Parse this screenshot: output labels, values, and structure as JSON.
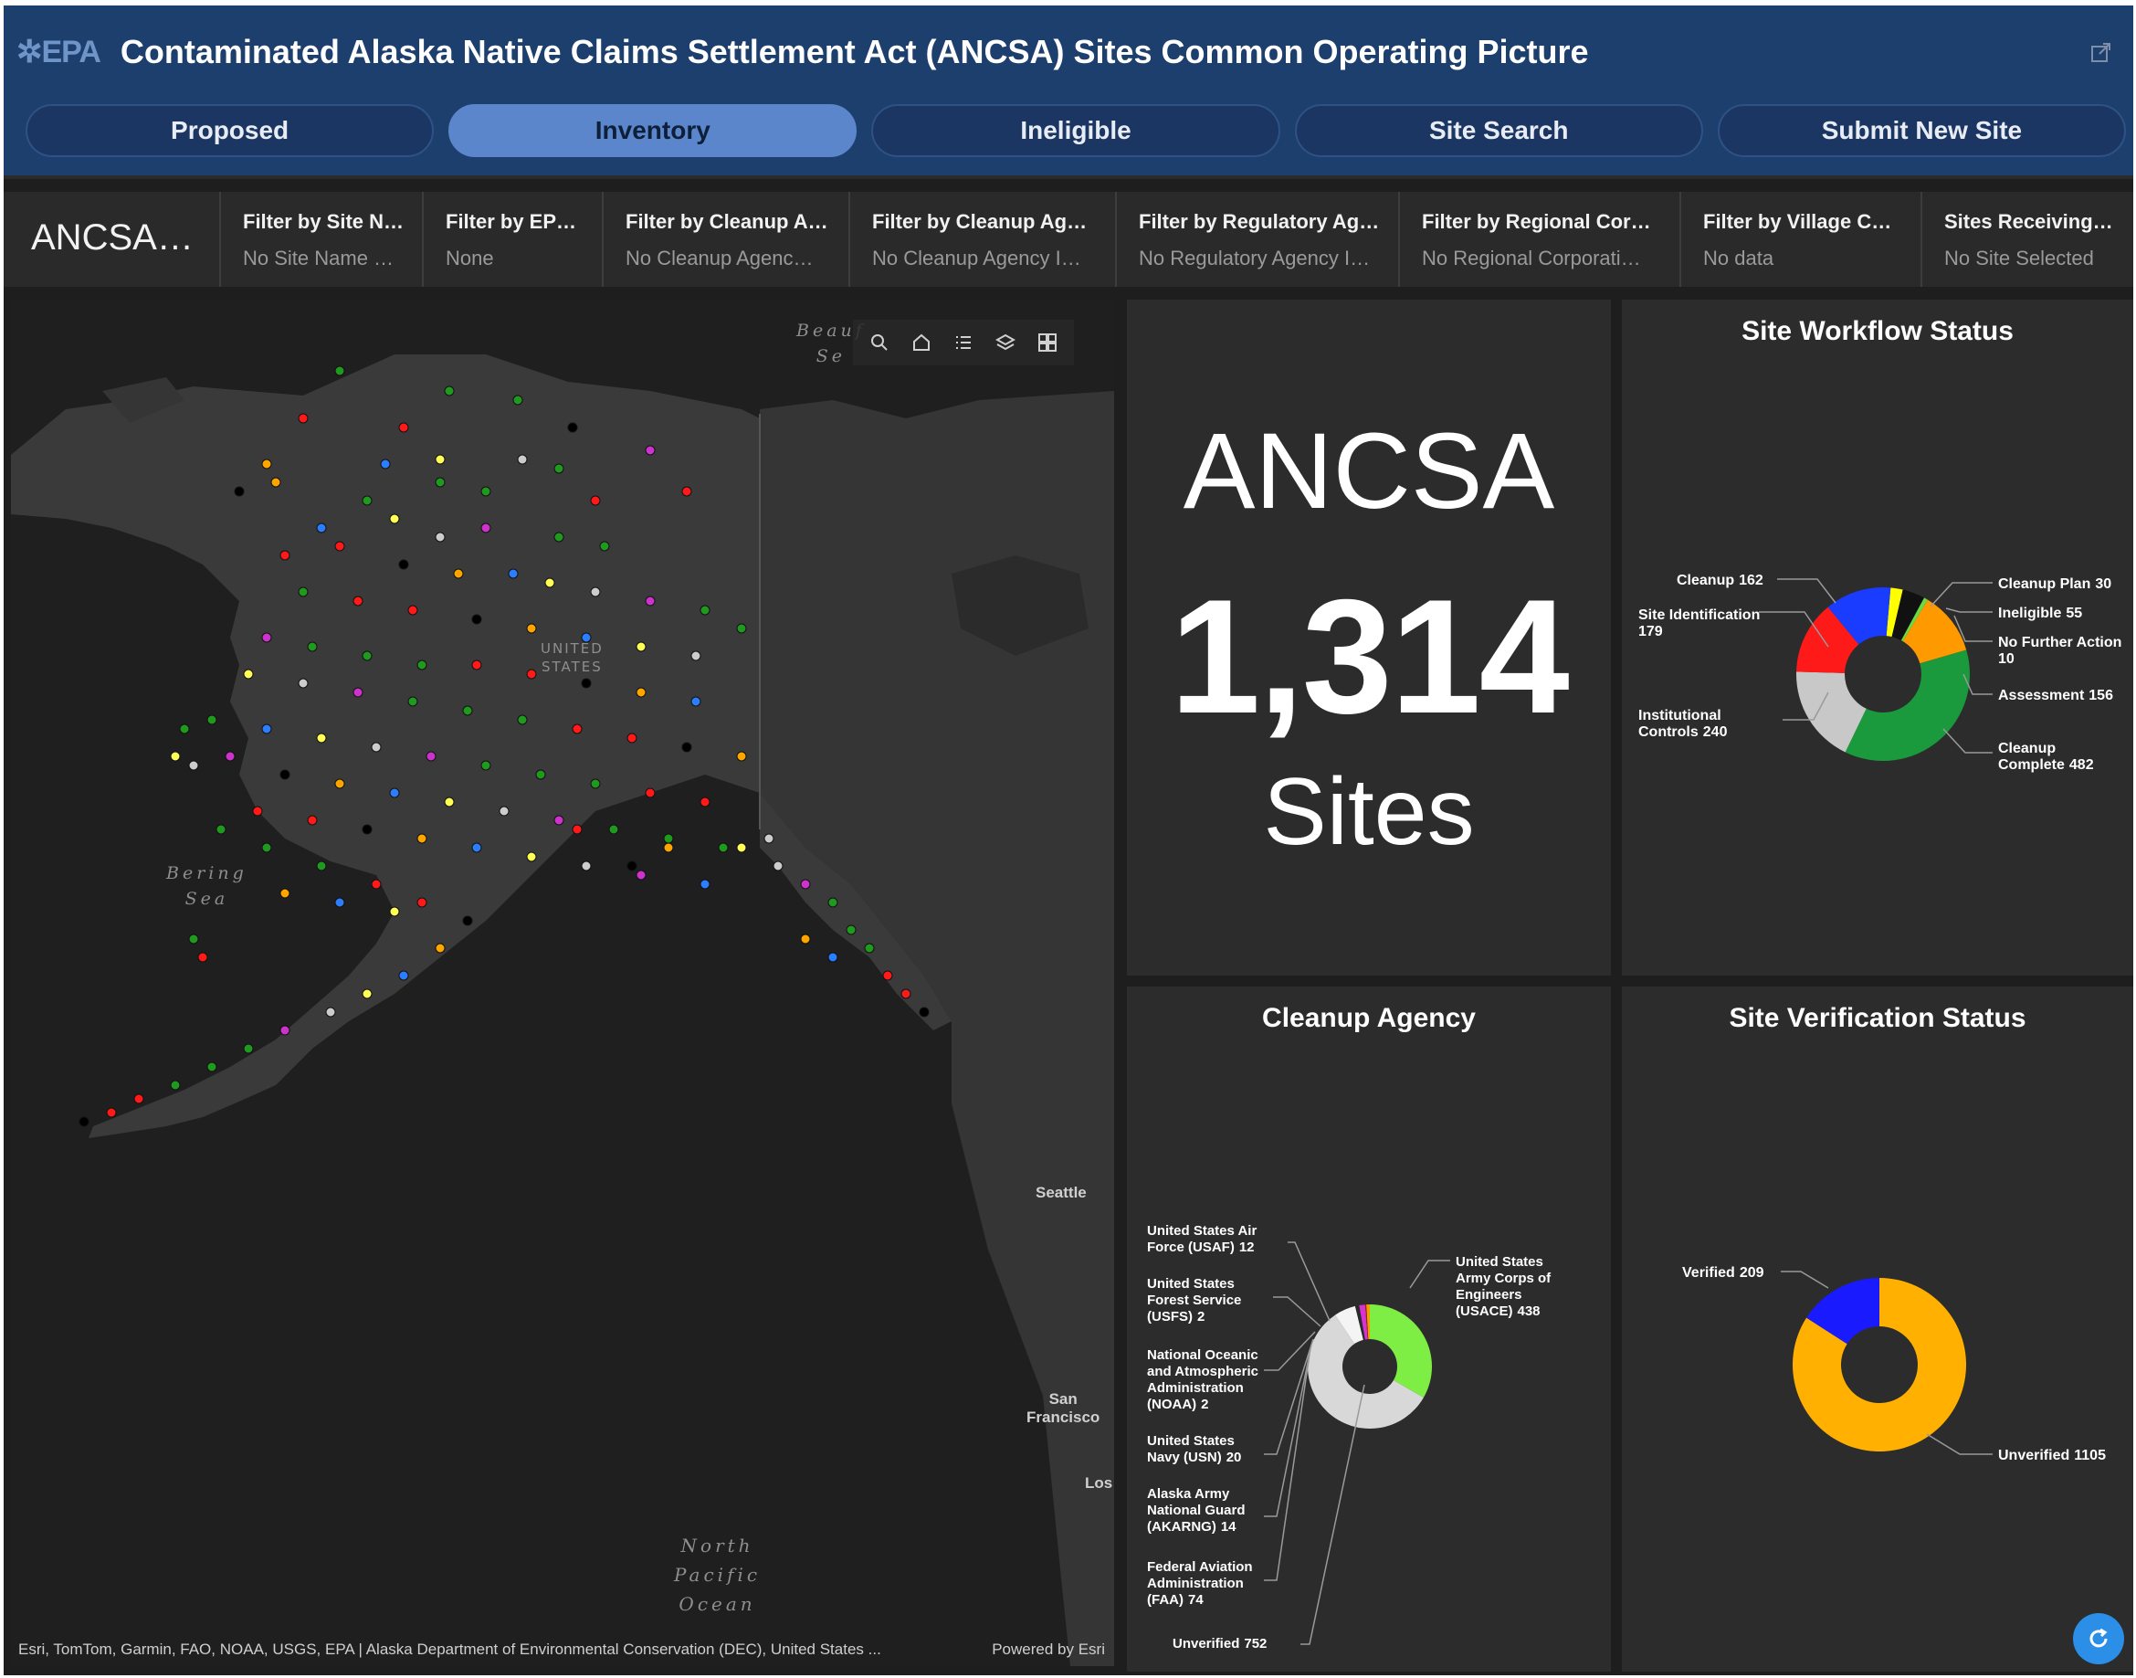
{
  "header": {
    "logo_text": "✲EPA",
    "title": "Contaminated  Alaska Native Claims Settlement Act (ANCSA) Sites Common Operating Picture",
    "share_icon": "share-icon"
  },
  "tabs": [
    {
      "label": "Proposed",
      "active": false
    },
    {
      "label": "Inventory",
      "active": true
    },
    {
      "label": "Ineligible",
      "active": false
    },
    {
      "label": "Site Search",
      "active": false
    },
    {
      "label": "Submit New Site",
      "active": false
    }
  ],
  "filters": {
    "selector_label": "ANCSA…",
    "items": [
      {
        "label": "Filter by Site N…",
        "value": "No Site Name …"
      },
      {
        "label": "Filter by EP…",
        "value": "None"
      },
      {
        "label": "Filter by Cleanup A…",
        "value": "No Cleanup Agenc…"
      },
      {
        "label": "Filter by Cleanup Ag…",
        "value": "No Cleanup Agency I…"
      },
      {
        "label": "Filter by Regulatory Ag…",
        "value": "No Regulatory Agency I…"
      },
      {
        "label": "Filter by Regional Corp…",
        "value": "No Regional Corporati…"
      },
      {
        "label": "Filter by Village C…",
        "value": "No data"
      },
      {
        "label": "Sites Receiving E…",
        "value": "No Site Selected"
      }
    ]
  },
  "map": {
    "labels": {
      "beaufort": "Beauf\nSe",
      "united_states": "UNITED\nSTATES",
      "bering": "Bering\nSea",
      "north_pacific": "North\nPacific\nOcean",
      "seattle": "Seattle",
      "san_francisco": "San\nFrancisco",
      "los": "Los"
    },
    "attribution": "Esri, TomTom, Garmin, FAO, NOAA, USGS, EPA | Alaska Department of Environmental Conservation (DEC), United States ...",
    "powered_by": "Powered by Esri",
    "tools": [
      "search-icon",
      "home-icon",
      "legend-icon",
      "layers-icon",
      "basemap-icon"
    ]
  },
  "indicator": {
    "label": "ANCSA",
    "value": "1,314",
    "unit": "Sites"
  },
  "colors": {
    "cleanup_complete": "#1a9a3c",
    "institutional_controls": "#c8c8c8",
    "site_identification": "#ff1a1a",
    "cleanup": "#1a3cff",
    "cleanup_plan": "#ffff00",
    "ineligible": "#111111",
    "no_further_action": "#66dd44",
    "assessment": "#ff9900",
    "verified": "#1a1aff",
    "unverified": "#ffb000",
    "usace": "#7fee44",
    "unverified_agency": "#d8d8d8"
  },
  "chart_data": [
    {
      "type": "pie",
      "title": "Site Workflow Status",
      "slices": [
        {
          "label": "Cleanup Plan 30",
          "name": "Cleanup Plan",
          "value": 30
        },
        {
          "label": "Ineligible 55",
          "name": "Ineligible",
          "value": 55
        },
        {
          "label": "No Further Action 10",
          "name": "No Further Action",
          "value": 10
        },
        {
          "label": "Assessment 156",
          "name": "Assessment",
          "value": 156
        },
        {
          "label": "Cleanup Complete 482",
          "name": "Cleanup Complete",
          "value": 482
        },
        {
          "label": "Institutional Controls 240",
          "name": "Institutional Controls",
          "value": 240
        },
        {
          "label": "Site Identification 179",
          "name": "Site Identification",
          "value": 179
        },
        {
          "label": "Cleanup 162",
          "name": "Cleanup",
          "value": 162
        }
      ]
    },
    {
      "type": "pie",
      "title": "Cleanup Agency",
      "slices": [
        {
          "label": "United States Army Corps of Engineers (USACE) 438",
          "name": "United States Army Corps of Engineers (USACE)",
          "value": 438
        },
        {
          "label": "Unverified 752",
          "name": "Unverified",
          "value": 752
        },
        {
          "label": "Federal Aviation Administration (FAA) 74",
          "name": "Federal Aviation Administration (FAA)",
          "value": 74
        },
        {
          "label": "Alaska Army National Guard (AKARNG) 14",
          "name": "Alaska Army National Guard (AKARNG)",
          "value": 14
        },
        {
          "label": "United States Navy (USN) 20",
          "name": "United States Navy (USN)",
          "value": 20
        },
        {
          "label": "National Oceanic and Atmospheric Administration (NOAA) 2",
          "name": "National Oceanic and Atmospheric Administration (NOAA)",
          "value": 2
        },
        {
          "label": "United States Forest Service (USFS) 2",
          "name": "United States Forest Service (USFS)",
          "value": 2
        },
        {
          "label": "United States Air Force (USAF) 12",
          "name": "United States Air Force (USAF)",
          "value": 12
        }
      ]
    },
    {
      "type": "pie",
      "title": "Site Verification Status",
      "slices": [
        {
          "label": "Unverified 1,105",
          "name": "Unverified",
          "value": 1105
        },
        {
          "label": "Verified 209",
          "name": "Verified",
          "value": 209
        }
      ]
    }
  ]
}
